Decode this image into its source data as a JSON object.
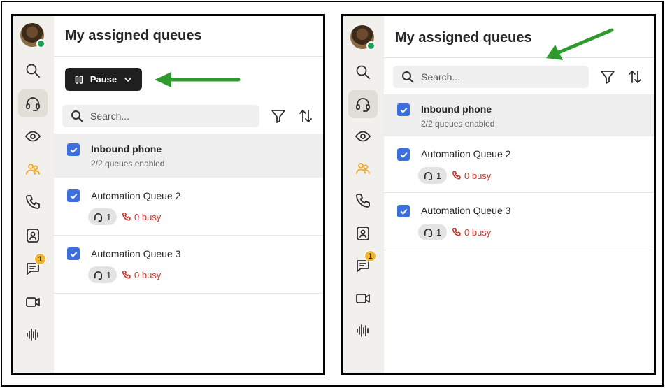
{
  "header": {
    "title": "My assigned queues"
  },
  "toolbar": {
    "pause_label": "Pause"
  },
  "search": {
    "placeholder": "Search..."
  },
  "rail": {
    "items": [
      "search-icon",
      "headset-icon",
      "eye-icon",
      "people-icon",
      "phone-icon",
      "contacts-icon",
      "chat-icon",
      "video-icon",
      "waveform-icon"
    ],
    "chat_badge": "1",
    "accent_color": "#f0a92b"
  },
  "queues": {
    "group": {
      "name": "Inbound phone",
      "status": "2/2 queues enabled"
    },
    "items": [
      {
        "name": "Automation Queue 2",
        "agents": "1",
        "busy": "0 busy"
      },
      {
        "name": "Automation Queue 3",
        "agents": "1",
        "busy": "0 busy"
      }
    ]
  },
  "colors": {
    "checkbox": "#3b6fe0",
    "busy": "#c8352b",
    "arrow": "#2e9a2e",
    "pause_button": "#1f1f1f"
  }
}
